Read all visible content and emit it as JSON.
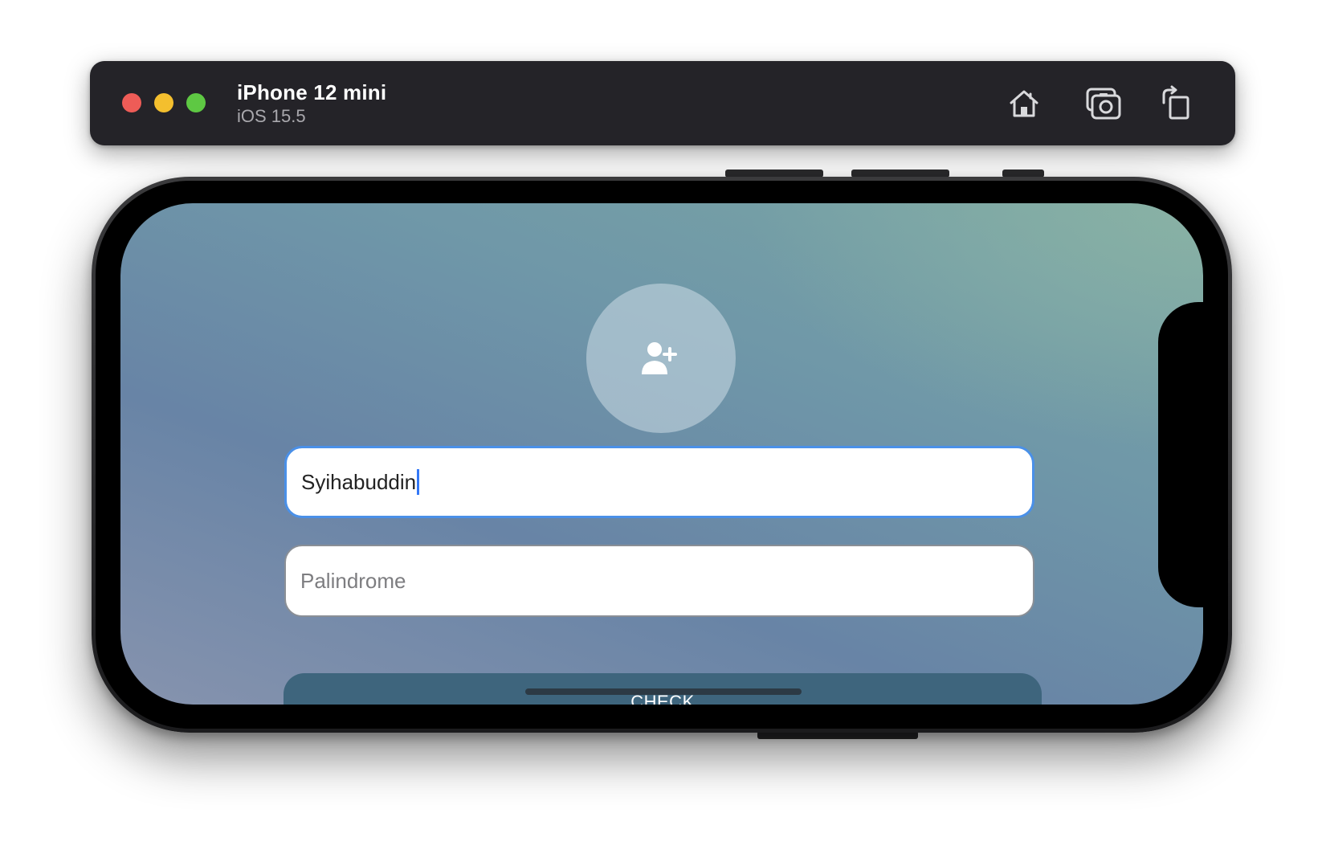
{
  "simulator": {
    "device_name": "iPhone 12 mini",
    "os_version": "iOS 15.5",
    "toolbar_icons": [
      "home-icon",
      "screenshot-icon",
      "rotate-icon"
    ]
  },
  "app": {
    "avatar_icon": "add-user-icon",
    "name_field": {
      "value": "Syihabuddin"
    },
    "palindrome_field": {
      "placeholder": "Palindrome"
    },
    "check_button": {
      "label": "CHECK"
    }
  },
  "colors": {
    "focus_border": "#4a90e8",
    "button_bg": "#3e657d",
    "traffic_red": "#ee5c57",
    "traffic_yellow": "#f4bf2e",
    "traffic_green": "#5ec843"
  }
}
